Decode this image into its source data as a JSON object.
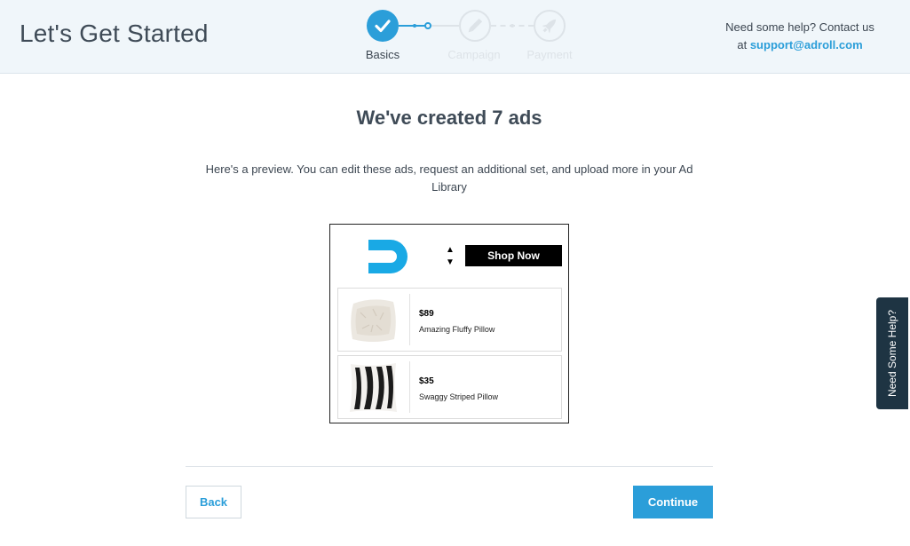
{
  "header": {
    "title": "Let's Get Started",
    "help_line1": "Need some help? Contact us",
    "help_prefix": "at",
    "help_email": "support@adroll.com"
  },
  "stepper": {
    "steps": [
      {
        "label": "Basics",
        "state": "complete",
        "icon": "check-icon"
      },
      {
        "label": "Campaign",
        "state": "inactive",
        "icon": "pencil-icon"
      },
      {
        "label": "Payment",
        "state": "inactive",
        "icon": "rocket-icon"
      }
    ]
  },
  "main": {
    "title": "We've created 7 ads",
    "subtitle": "Here's a preview. You can edit these ads, request an additional set, and upload more in your Ad Library"
  },
  "ad_preview": {
    "logo_icon": "adroll-logo-icon",
    "shop_label": "Shop Now",
    "products": [
      {
        "price": "$89",
        "name": "Amazing Fluffy Pillow",
        "image": "fluffy-pillow-image"
      },
      {
        "price": "$35",
        "name": "Swaggy Striped Pillow",
        "image": "striped-pillow-image"
      }
    ]
  },
  "footer": {
    "back_label": "Back",
    "continue_label": "Continue"
  },
  "side_tab": {
    "label": "Need Some Help?"
  },
  "colors": {
    "accent": "#2b9ed9",
    "header_bg": "#f0f6fa",
    "side_tab_bg": "#1e3443"
  }
}
